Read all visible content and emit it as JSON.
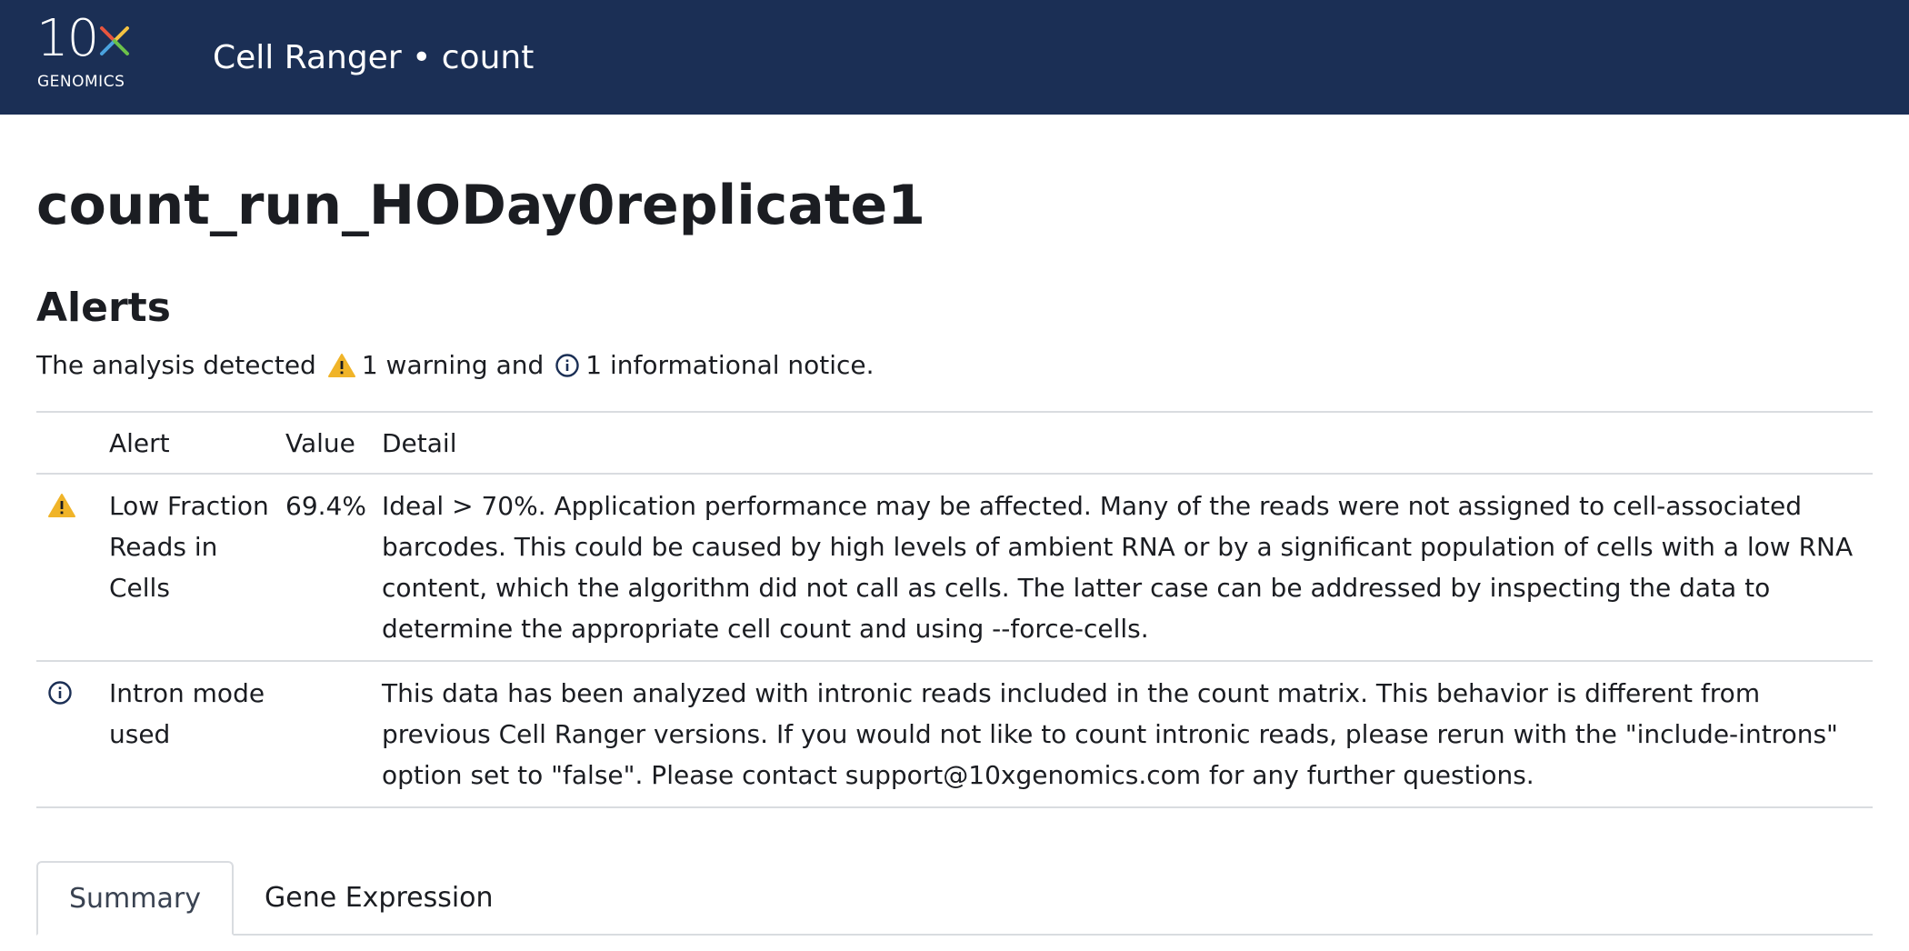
{
  "header": {
    "logo_text": "10x",
    "logo_sub": "GENOMICS",
    "app_title": "Cell Ranger • count"
  },
  "page_title": "count_run_HODay0replicate1",
  "alerts": {
    "title": "Alerts",
    "summary_prefix": "The analysis detected",
    "summary_warning": "1 warning and",
    "summary_info": "1 informational notice.",
    "columns": [
      "Alert",
      "Value",
      "Detail"
    ],
    "rows": [
      {
        "icon": "warning-icon",
        "alert": "Low Fraction Reads in Cells",
        "value": "69.4%",
        "detail": "Ideal > 70%. Application performance may be affected. Many of the reads were not assigned to cell-associated barcodes. This could be caused by high levels of ambient RNA or by a significant population of cells with a low RNA content, which the algorithm did not call as cells. The latter case can be addressed by inspecting the data to determine the appropriate cell count and using --force-cells."
      },
      {
        "icon": "info-icon",
        "alert": "Intron mode used",
        "value": "",
        "detail": "This data has been analyzed with intronic reads included in the count matrix. This behavior is different from previous Cell Ranger versions. If you would not like to count intronic reads, please rerun with the \"include-introns\" option set to \"false\". Please contact support@10xgenomics.com for any further questions."
      }
    ]
  },
  "tabs": [
    {
      "label": "Summary",
      "active": true
    },
    {
      "label": "Gene Expression",
      "active": false
    }
  ],
  "colors": {
    "header_bg": "#1b2f55",
    "warning": "#f0b429",
    "info": "#1b2f55",
    "logo_x_red": "#e8553e",
    "logo_x_blue": "#4aa3df",
    "logo_x_green": "#6cc24a",
    "logo_x_yellow": "#f5c342"
  }
}
